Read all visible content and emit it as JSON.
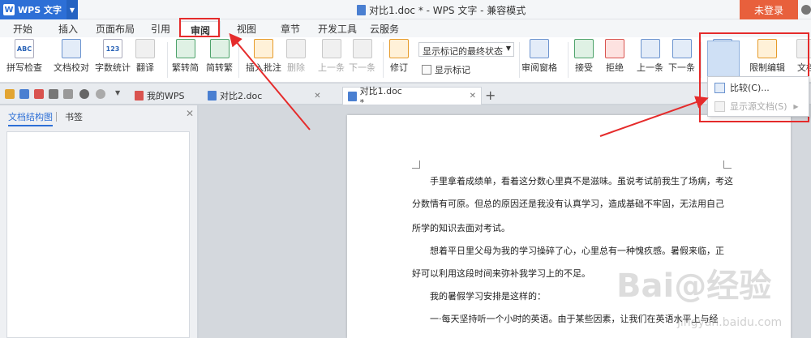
{
  "titlebar": {
    "app_name": "WPS 文字",
    "document_title": "对比1.doc * - WPS 文字 - 兼容模式",
    "login_label": "未登录"
  },
  "menu": {
    "tabs": [
      "开始",
      "插入",
      "页面布局",
      "引用",
      "审阅",
      "视图",
      "章节",
      "开发工具",
      "云服务"
    ],
    "active": "审阅"
  },
  "ribbon": {
    "spell_check": "拼写检查",
    "doc_proof": "文档校对",
    "word_count": "字数统计",
    "translate": "翻译",
    "trad_to_simp": "繁转简",
    "simp_to_trad": "简转繁",
    "insert_comment": "插入批注",
    "delete": "删除",
    "prev": "上一条",
    "next": "下一条",
    "track_changes": "修订",
    "display_select": "显示标记的最终状态",
    "show_markup": "显示标记",
    "review_pane": "审阅窗格",
    "accept": "接受",
    "reject": "拒绝",
    "prev2": "上一条",
    "next2": "下一条",
    "compare": "比较",
    "restrict_edit": "限制编辑",
    "doc_more": "文档"
  },
  "doc_tabs": {
    "my_wps": "我的WPS",
    "tab1": "对比2.doc",
    "tab2": "对比1.doc *"
  },
  "compare_menu": {
    "item1": "比较(C)...",
    "item2": "显示源文档(S)"
  },
  "left_pane": {
    "tab1": "文档结构图",
    "tab2": "书签"
  },
  "document": {
    "lines": [
      "手里拿着成绩单，看着这分数心里真不是滋味。虽说考试前我生了场病，考这",
      "分数情有可原。但总的原因还是我没有认真学习，造成基础不牢固，无法用自己",
      "所学的知识去面对考试。",
      "想着平日里父母为我的学习操碎了心，心里总有一种愧疚感。暑假来临，正",
      "好可以利用这段时间来弥补我学习上的不足。",
      "我的暑假学习安排是这样的：",
      "一·每天坚持听一个小时的英语。由于某些因素，让我们在英语水平上与经"
    ]
  },
  "watermark": {
    "main": "Bai@经验",
    "sub": "jingyan.baidu.com"
  },
  "colors": {
    "accent": "#2d6fd6",
    "annotation": "#e52b2b",
    "login": "#e8603c"
  }
}
